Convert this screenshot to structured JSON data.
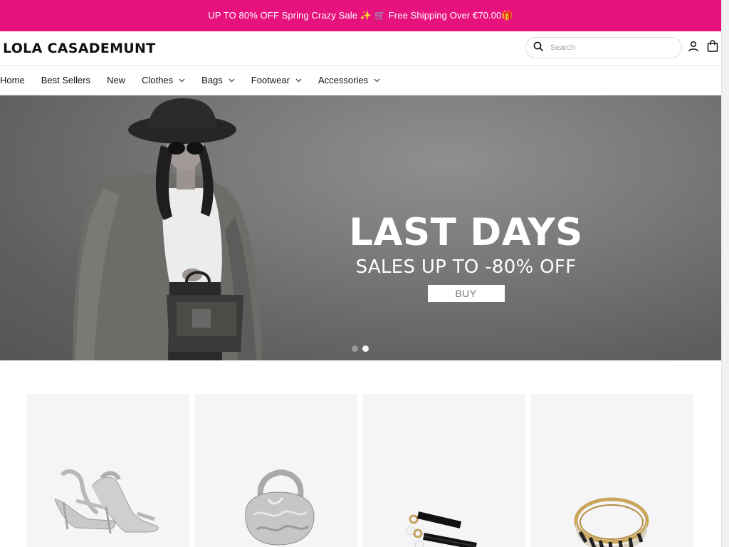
{
  "announcement": {
    "text": "UP TO 80% OFF Spring Crazy Sale ✨ 🛒 Free Shipping Over €70.00🎁",
    "background": "#e8127f"
  },
  "header": {
    "logo": "LOLA CASADEMUNT",
    "search": {
      "placeholder": "Search",
      "value": ""
    },
    "icons": [
      "search-icon",
      "user-icon",
      "shopping-bag-icon"
    ]
  },
  "nav": {
    "items": [
      {
        "label": "Home",
        "dropdown": false
      },
      {
        "label": "Best Sellers",
        "dropdown": false
      },
      {
        "label": "New",
        "dropdown": false
      },
      {
        "label": "Clothes",
        "dropdown": true
      },
      {
        "label": "Bags",
        "dropdown": true
      },
      {
        "label": "Footwear",
        "dropdown": true
      },
      {
        "label": "Accessories",
        "dropdown": true
      }
    ]
  },
  "hero": {
    "title": "LAST DAYS",
    "subtitle": "SALES UP TO -80% OFF",
    "button_label": "BUY",
    "slides": 2,
    "active_slide": 2
  },
  "products": {
    "items": [
      {
        "icon": "silver-heeled-sandal-icon"
      },
      {
        "icon": "silver-ruched-bag-icon"
      },
      {
        "icon": "black-bar-earrings-icon"
      },
      {
        "icon": "gold-bangle-bracelet-icon"
      }
    ]
  }
}
